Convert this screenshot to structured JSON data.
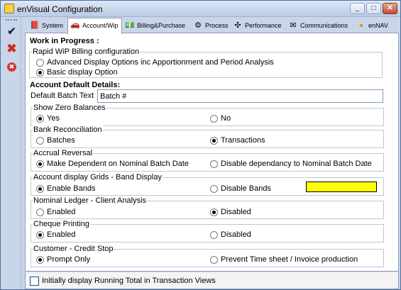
{
  "window": {
    "title": "enVisual Configuration",
    "controls": {
      "minimize": "_",
      "maximize": "□",
      "close": "✕"
    }
  },
  "toolbar": {
    "buttons": [
      {
        "name": "ok-icon",
        "glyph": "✔"
      },
      {
        "name": "close-x-icon",
        "glyph": "✖"
      },
      {
        "name": "cancel-icon",
        "glyph": "✖"
      }
    ]
  },
  "tabs": [
    {
      "label": "System",
      "icon": "book-icon",
      "glyph": "📕",
      "active": false
    },
    {
      "label": "Account/Wip",
      "icon": "car-icon",
      "glyph": "🚗",
      "active": true
    },
    {
      "label": "Billing&Purchase",
      "icon": "money-icon",
      "glyph": "💵",
      "active": false
    },
    {
      "label": "Process",
      "icon": "gears-icon",
      "glyph": "⚙",
      "active": false
    },
    {
      "label": "Performance",
      "icon": "performance-icon",
      "glyph": "✣",
      "active": false
    },
    {
      "label": "Communications",
      "icon": "envelope-icon",
      "glyph": "✉",
      "active": false
    },
    {
      "label": "enNAV",
      "icon": "globe-icon",
      "glyph": "●",
      "active": false
    }
  ],
  "wip": {
    "heading": "Work in Progress :",
    "rapid_title": "Rapid WiP Billing configuration",
    "option_advanced": "Advanced Display Options inc Apportionment and Period Analysis",
    "option_basic": "Basic display Option",
    "selected": "basic"
  },
  "account": {
    "heading": "Account Default Details:",
    "batch_label": "Default Batch Text",
    "batch_value": "Batch #"
  },
  "groups": {
    "zero_balances": {
      "title": "Show Zero Balances",
      "opt1": "Yes",
      "opt2": "No",
      "selected": "opt1"
    },
    "bank_reconciliation": {
      "title": "Bank Reconciliation",
      "opt1": "Batches",
      "opt2": "Transactions",
      "selected": "opt2"
    },
    "accrual_reversal": {
      "title": "Accrual Reversal",
      "opt1": "Make Dependent on Nominal Batch Date",
      "opt2": "Disable dependancy to Nominal Batch Date",
      "selected": "opt1"
    },
    "grid_bands": {
      "title": "Account display Grids - Band Display",
      "opt1": "Enable Bands",
      "opt2": "Disable Bands",
      "selected": "opt1",
      "band_color": "#ffff00"
    },
    "client_analysis": {
      "title": "Nominal Ledger - Client Analysis",
      "opt1": "Enabled",
      "opt2": "Disabled",
      "selected": "opt2"
    },
    "cheque_printing": {
      "title": "Cheque Printing",
      "opt1": "Enabled",
      "opt2": "Disabled",
      "selected": "opt1"
    },
    "credit_stop": {
      "title": "Customer - Credit Stop",
      "opt1": "Prompt Only",
      "opt2": "Prevent Time sheet / Invoice production",
      "selected": "opt1"
    }
  },
  "footer": {
    "running_total_label": "Initially display Running Total in Transaction Views",
    "running_total_checked": false
  },
  "colors": {
    "window_bg": "#c9d6ea",
    "panel_bg": "#ffffff",
    "band_swatch": "#ffff00",
    "close_button": "#c2492f"
  }
}
